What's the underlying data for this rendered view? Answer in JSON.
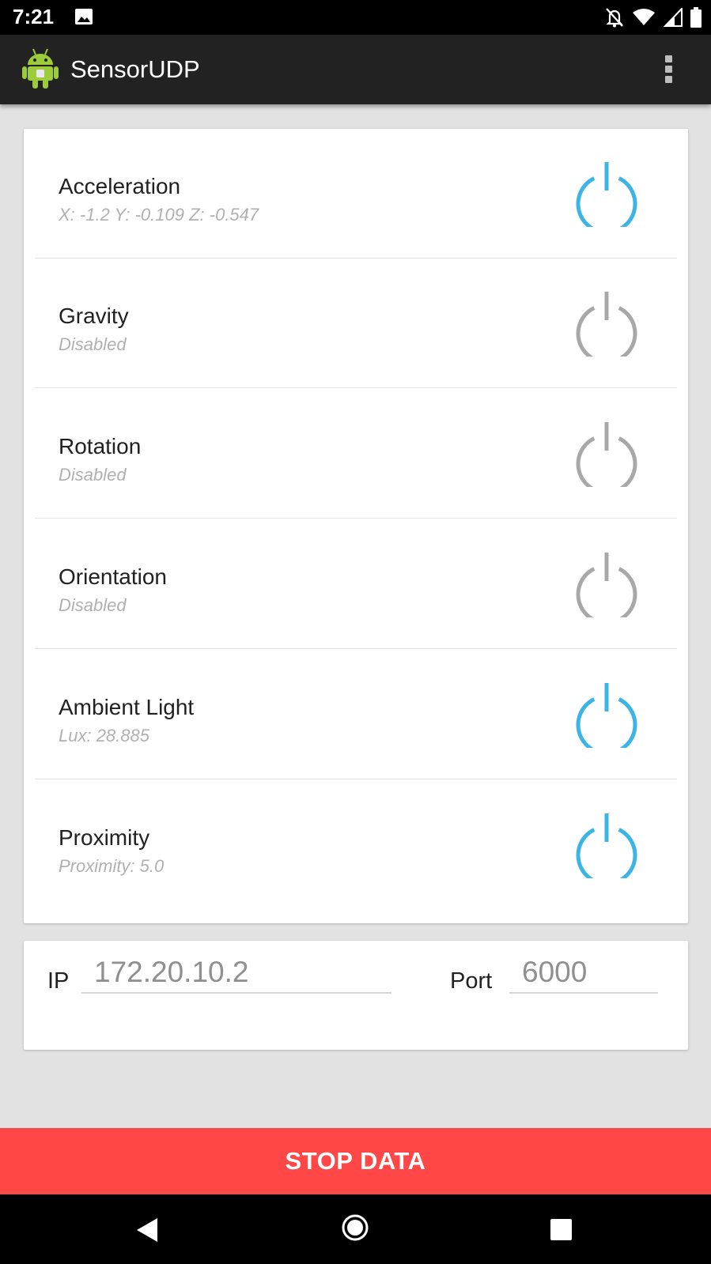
{
  "status_bar": {
    "time": "7:21",
    "icons": [
      "image-notification-icon",
      "alarm-off-icon",
      "wifi-icon",
      "cell-signal-icon",
      "battery-icon"
    ]
  },
  "app_bar": {
    "title": "SensorUDP",
    "logo_icon": "android-robot-icon",
    "menu_icon": "overflow-menu-icon"
  },
  "colors": {
    "active_power": "#3cb4e5",
    "inactive_power": "#a8a8a8",
    "stop_button": "#ff4747",
    "app_bar": "#222222"
  },
  "sensors": [
    {
      "name": "Acceleration",
      "status": "X: -1.2 Y: -0.109 Z: -0.547",
      "enabled": true
    },
    {
      "name": "Gravity",
      "status": "Disabled",
      "enabled": false
    },
    {
      "name": "Rotation",
      "status": "Disabled",
      "enabled": false
    },
    {
      "name": "Orientation",
      "status": "Disabled",
      "enabled": false
    },
    {
      "name": "Ambient Light",
      "status": "Lux: 28.885",
      "enabled": true
    },
    {
      "name": "Proximity",
      "status": "Proximity: 5.0",
      "enabled": true
    }
  ],
  "network": {
    "ip_label": "IP",
    "ip_value": "172.20.10.2",
    "port_label": "Port",
    "port_value": "6000"
  },
  "stop_button_label": "STOP DATA"
}
